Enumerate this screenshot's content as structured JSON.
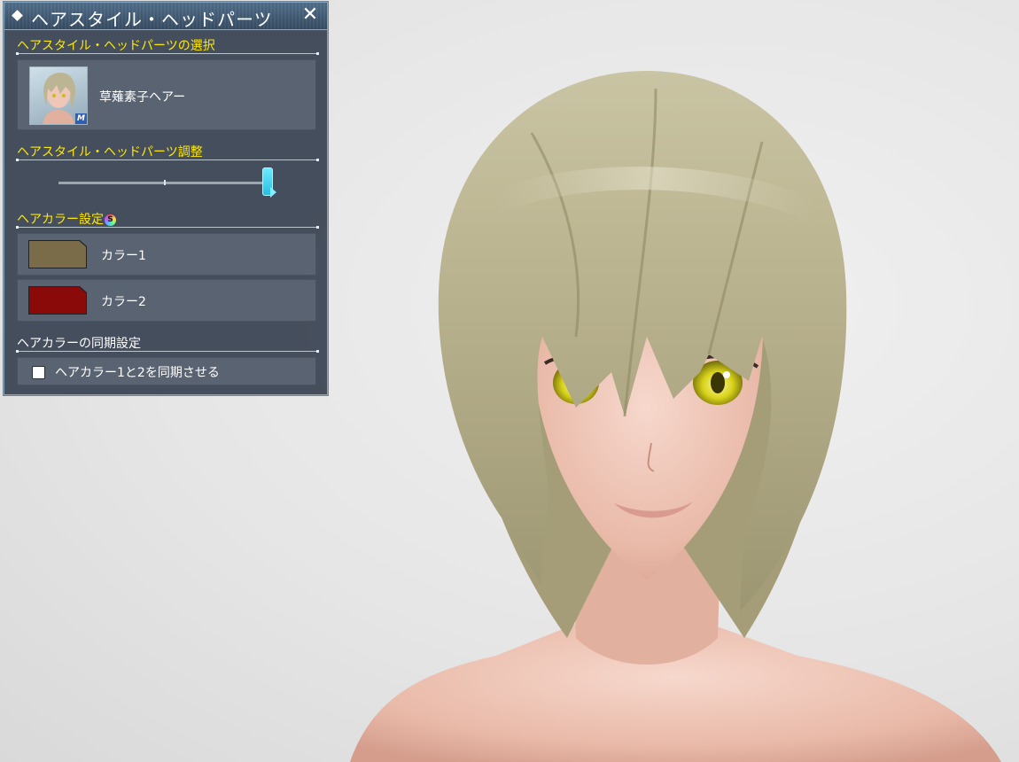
{
  "window": {
    "title": "ヘアスタイル・ヘッドパーツ",
    "close_glyph": "✕"
  },
  "selection": {
    "heading": "ヘアスタイル・ヘッドパーツの選択",
    "item_name": "草薙素子ヘアー",
    "thumb_badge": "M"
  },
  "adjust": {
    "heading": "ヘアスタイル・ヘッドパーツ調整",
    "slider_value": 0.98
  },
  "colors": {
    "heading": "ヘアカラー設定",
    "badge": "S",
    "items": [
      {
        "label": "カラー1",
        "color": "#7a6c48"
      },
      {
        "label": "カラー2",
        "color": "#8a0a0a"
      }
    ]
  },
  "sync": {
    "heading": "ヘアカラーの同期設定",
    "checkbox_label": "ヘアカラー1と2を同期させる",
    "checked": false
  },
  "theme": {
    "heading_color": "#ffe800",
    "accent": "#2fd3f2",
    "panel_bg": "#3e4856"
  }
}
